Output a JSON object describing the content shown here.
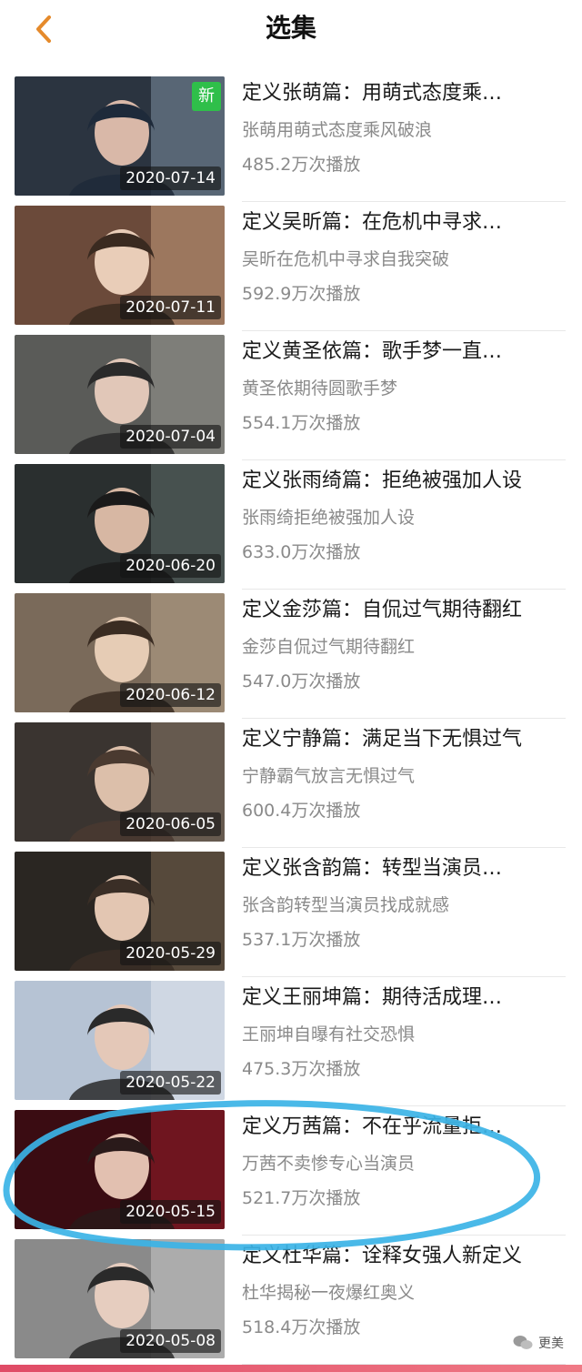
{
  "header": {
    "title": "选集"
  },
  "accent": "#e58a2b",
  "episodes": [
    {
      "title": "定义张萌篇：用萌式态度乘…",
      "subtitle": "张萌用萌式态度乘风破浪",
      "plays": "485.2万次播放",
      "date": "2020-07-14",
      "badge": "新"
    },
    {
      "title": "定义吴昕篇：在危机中寻求…",
      "subtitle": "吴昕在危机中寻求自我突破",
      "plays": "592.9万次播放",
      "date": "2020-07-11"
    },
    {
      "title": "定义黄圣依篇：歌手梦一直…",
      "subtitle": "黄圣依期待圆歌手梦",
      "plays": "554.1万次播放",
      "date": "2020-07-04"
    },
    {
      "title": "定义张雨绮篇：拒绝被强加人设",
      "subtitle": "张雨绮拒绝被强加人设",
      "plays": "633.0万次播放",
      "date": "2020-06-20"
    },
    {
      "title": "定义金莎篇：自侃过气期待翻红",
      "subtitle": "金莎自侃过气期待翻红",
      "plays": "547.0万次播放",
      "date": "2020-06-12"
    },
    {
      "title": "定义宁静篇：满足当下无惧过气",
      "subtitle": "宁静霸气放言无惧过气",
      "plays": "600.4万次播放",
      "date": "2020-06-05"
    },
    {
      "title": "定义张含韵篇：转型当演员…",
      "subtitle": "张含韵转型当演员找成就感",
      "plays": "537.1万次播放",
      "date": "2020-05-29"
    },
    {
      "title": "定义王丽坤篇：期待活成理…",
      "subtitle": "王丽坤自曝有社交恐惧",
      "plays": "475.3万次播放",
      "date": "2020-05-22"
    },
    {
      "title": "定义万茜篇：不在乎流量拒…",
      "subtitle": "万茜不卖惨专心当演员",
      "plays": "521.7万次播放",
      "date": "2020-05-15"
    },
    {
      "title": "定义杜华篇：诠释女强人新定义",
      "subtitle": "杜华揭秘一夜爆红奥义",
      "plays": "518.4万次播放",
      "date": "2020-05-08"
    }
  ],
  "watermark": {
    "text": "更美"
  }
}
